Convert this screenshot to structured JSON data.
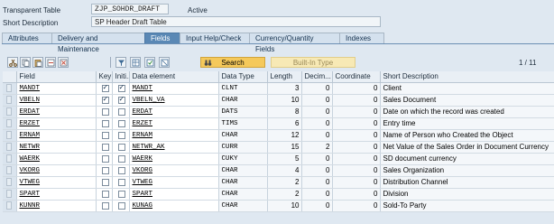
{
  "header": {
    "table_type_label": "Transparent Table",
    "table_name": "ZJP_SOHDR_DRAFT",
    "status": "Active",
    "short_desc_label": "Short Description",
    "short_desc_value": "SP Header Draft Table"
  },
  "tabs": [
    {
      "label": "Attributes",
      "active": false
    },
    {
      "label": "Delivery and Maintenance",
      "active": false
    },
    {
      "label": "Fields",
      "active": true
    },
    {
      "label": "Input Help/Check",
      "active": false
    },
    {
      "label": "Currency/Quantity Fields",
      "active": false
    },
    {
      "label": "Indexes",
      "active": false
    }
  ],
  "toolbar": {
    "search_label": "Search",
    "builtin_label": "Built-In Type",
    "pager": "1  /  11"
  },
  "columns": {
    "field": "Field",
    "key": "Key",
    "init": "Initi...",
    "data_element": "Data element",
    "data_type": "Data Type",
    "length": "Length",
    "decimals": "Decim...",
    "coordinate": "Coordinate",
    "short_desc": "Short Description"
  },
  "rows": [
    {
      "field": "MANDT",
      "key": true,
      "init": true,
      "de": "MANDT",
      "type": "CLNT",
      "len": "3",
      "dec": "0",
      "coord": "0",
      "desc": "Client"
    },
    {
      "field": "VBELN",
      "key": true,
      "init": true,
      "de": "VBELN_VA",
      "type": "CHAR",
      "len": "10",
      "dec": "0",
      "coord": "0",
      "desc": "Sales Document"
    },
    {
      "field": "ERDAT",
      "key": false,
      "init": false,
      "de": "ERDAT",
      "type": "DATS",
      "len": "8",
      "dec": "0",
      "coord": "0",
      "desc": "Date on which the record was created"
    },
    {
      "field": "ERZET",
      "key": false,
      "init": false,
      "de": "ERZET",
      "type": "TIMS",
      "len": "6",
      "dec": "0",
      "coord": "0",
      "desc": "Entry time"
    },
    {
      "field": "ERNAM",
      "key": false,
      "init": false,
      "de": "ERNAM",
      "type": "CHAR",
      "len": "12",
      "dec": "0",
      "coord": "0",
      "desc": "Name of Person who Created the Object"
    },
    {
      "field": "NETWR",
      "key": false,
      "init": false,
      "de": "NETWR_AK",
      "type": "CURR",
      "len": "15",
      "dec": "2",
      "coord": "0",
      "desc": "Net Value of the Sales Order in Document Currency"
    },
    {
      "field": "WAERK",
      "key": false,
      "init": false,
      "de": "WAERK",
      "type": "CUKY",
      "len": "5",
      "dec": "0",
      "coord": "0",
      "desc": "SD document currency"
    },
    {
      "field": "VKORG",
      "key": false,
      "init": false,
      "de": "VKORG",
      "type": "CHAR",
      "len": "4",
      "dec": "0",
      "coord": "0",
      "desc": "Sales Organization"
    },
    {
      "field": "VTWEG",
      "key": false,
      "init": false,
      "de": "VTWEG",
      "type": "CHAR",
      "len": "2",
      "dec": "0",
      "coord": "0",
      "desc": "Distribution Channel"
    },
    {
      "field": "SPART",
      "key": false,
      "init": false,
      "de": "SPART",
      "type": "CHAR",
      "len": "2",
      "dec": "0",
      "coord": "0",
      "desc": "Division"
    },
    {
      "field": "KUNNR",
      "key": false,
      "init": false,
      "de": "KUNAG",
      "type": "CHAR",
      "len": "10",
      "dec": "0",
      "coord": "0",
      "desc": "Sold-To Party"
    }
  ]
}
